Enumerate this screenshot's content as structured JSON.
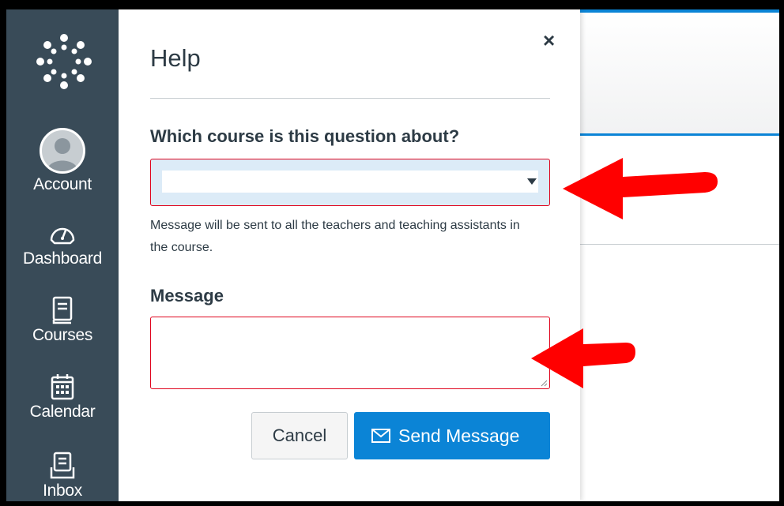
{
  "nav": {
    "logo_icon": "canvas-logo-icon",
    "items": [
      {
        "label": "Account",
        "icon": "avatar"
      },
      {
        "label": "Dashboard",
        "icon": "dashboard-icon"
      },
      {
        "label": "Courses",
        "icon": "book-icon"
      },
      {
        "label": "Calendar",
        "icon": "calendar-icon"
      },
      {
        "label": "Inbox",
        "icon": "inbox-icon"
      }
    ],
    "background_color": "#394b58"
  },
  "help_panel": {
    "title": "Help",
    "close_label": "×",
    "course_label": "Which course is this question about?",
    "course_select_value": "",
    "help_text": "Message will be sent to all the teachers and teaching assistants in the course.",
    "message_label": "Message",
    "message_value": "",
    "cancel_label": "Cancel",
    "send_label": "Send Message",
    "accent_color": "#0b84d6",
    "error_border_color": "#e0061f"
  },
  "annotations": {
    "arrow_color": "#ff0000"
  }
}
